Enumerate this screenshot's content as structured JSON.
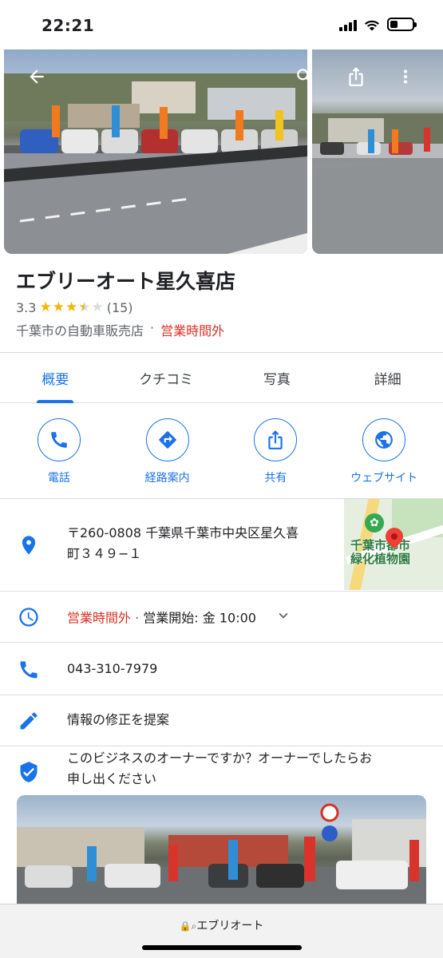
{
  "status_bar": {
    "time": "22:21"
  },
  "place": {
    "name": "エブリーオート星久喜店",
    "rating": "3.3",
    "rating_value": 3.3,
    "review_count": "(15)",
    "category": "千葉市の自動車販売店",
    "separator": "·",
    "open_status": "営業時間外"
  },
  "tabs": [
    {
      "label": "概要",
      "active": true
    },
    {
      "label": "クチコミ",
      "active": false
    },
    {
      "label": "写真",
      "active": false
    },
    {
      "label": "詳細",
      "active": false
    }
  ],
  "actions": [
    {
      "label": "電話",
      "icon": "phone-icon"
    },
    {
      "label": "経路案内",
      "icon": "directions-icon"
    },
    {
      "label": "共有",
      "icon": "share-icon"
    },
    {
      "label": "ウェブサイト",
      "icon": "globe-icon"
    }
  ],
  "address": {
    "line1": "〒260-0808 千葉県千葉市中央区星久喜",
    "line2": "町３４９−１",
    "map_label_line1": "千葉市都市",
    "map_label_line2": "緑化植物園"
  },
  "hours": {
    "status": "営業時間外",
    "separator": "·",
    "next_open": "営業開始: 金 10:00"
  },
  "phone": "043-310-7979",
  "suggest_edit": "情報の修正を提案",
  "owner_claim": {
    "line1": "このビジネスのオーナーですか？オーナーでしたらお",
    "line2": "申し出ください"
  },
  "url_bar": {
    "text": "エブリオート"
  },
  "colors": {
    "accent": "#1a73e8",
    "closed": "#d93025",
    "star": "#f5b400"
  }
}
